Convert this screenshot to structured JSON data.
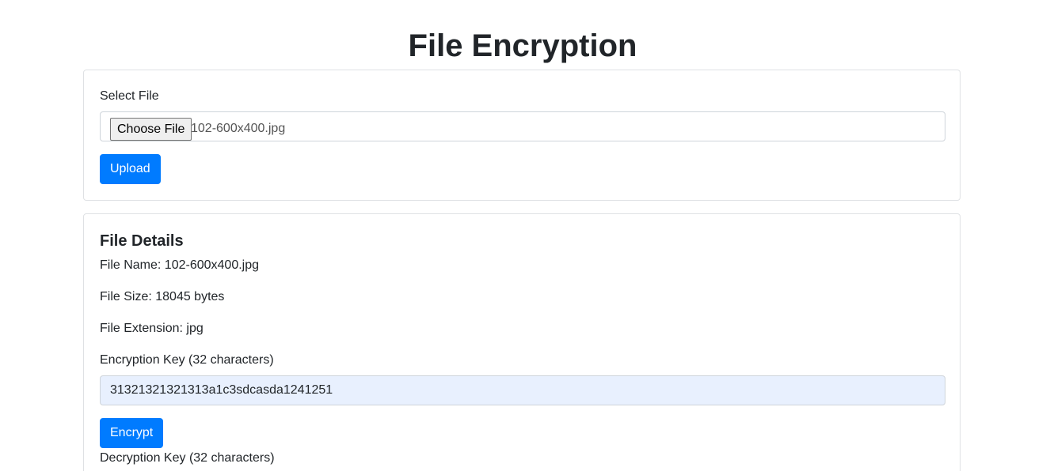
{
  "page": {
    "title": "File Encryption"
  },
  "upload": {
    "select_label": "Select File",
    "choose_button": "Choose File",
    "chosen_file": "102-600x400.jpg",
    "upload_button": "Upload"
  },
  "details": {
    "heading": "File Details",
    "file_name": "File Name: 102-600x400.jpg",
    "file_size": "File Size: 18045 bytes",
    "file_extension": "File Extension: jpg",
    "encryption_key_label": "Encryption Key (32 characters)",
    "encryption_key_value": "31321321321313a1c3sdcasda1241251",
    "encrypt_button": "Encrypt",
    "decryption_key_label": "Decryption Key (32 characters)"
  },
  "colors": {
    "primary": "#007bff",
    "autofill_background": "#e8f0fe",
    "border": "#dfe1e4",
    "text": "#212529"
  }
}
